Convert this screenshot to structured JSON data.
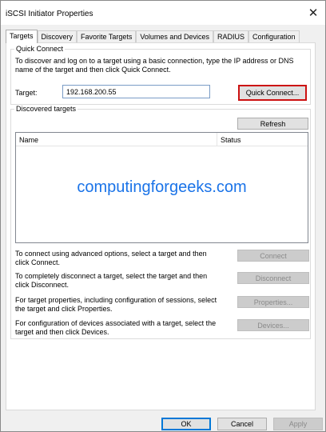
{
  "window": {
    "title": "iSCSI Initiator Properties",
    "close_glyph": "✕"
  },
  "tabs": [
    {
      "label": "Targets",
      "active": true
    },
    {
      "label": "Discovery",
      "active": false
    },
    {
      "label": "Favorite Targets",
      "active": false
    },
    {
      "label": "Volumes and Devices",
      "active": false
    },
    {
      "label": "RADIUS",
      "active": false
    },
    {
      "label": "Configuration",
      "active": false
    }
  ],
  "quick_connect": {
    "group_label": "Quick Connect",
    "description": "To discover and log on to a target using a basic connection, type the IP address or DNS name of the target and then click Quick Connect.",
    "target_label": "Target:",
    "target_value": "192.168.200.55",
    "button_label": "Quick Connect..."
  },
  "discovered": {
    "group_label": "Discovered targets",
    "refresh_label": "Refresh",
    "columns": {
      "name": "Name",
      "status": "Status"
    },
    "watermark": "computingforgeeks.com",
    "actions": [
      {
        "text": "To connect using advanced options, select a target and then click Connect.",
        "button": "Connect"
      },
      {
        "text": "To completely disconnect a target, select the target and then click Disconnect.",
        "button": "Disconnect"
      },
      {
        "text": "For target properties, including configuration of sessions, select the target and click Properties.",
        "button": "Properties..."
      },
      {
        "text": "For configuration of devices associated with a target, select the target and then click Devices.",
        "button": "Devices..."
      }
    ]
  },
  "footer": {
    "ok_label": "OK",
    "cancel_label": "Cancel",
    "apply_label": "Apply"
  },
  "colors": {
    "highlight": "#cc1111",
    "watermark": "#1a73e8"
  }
}
